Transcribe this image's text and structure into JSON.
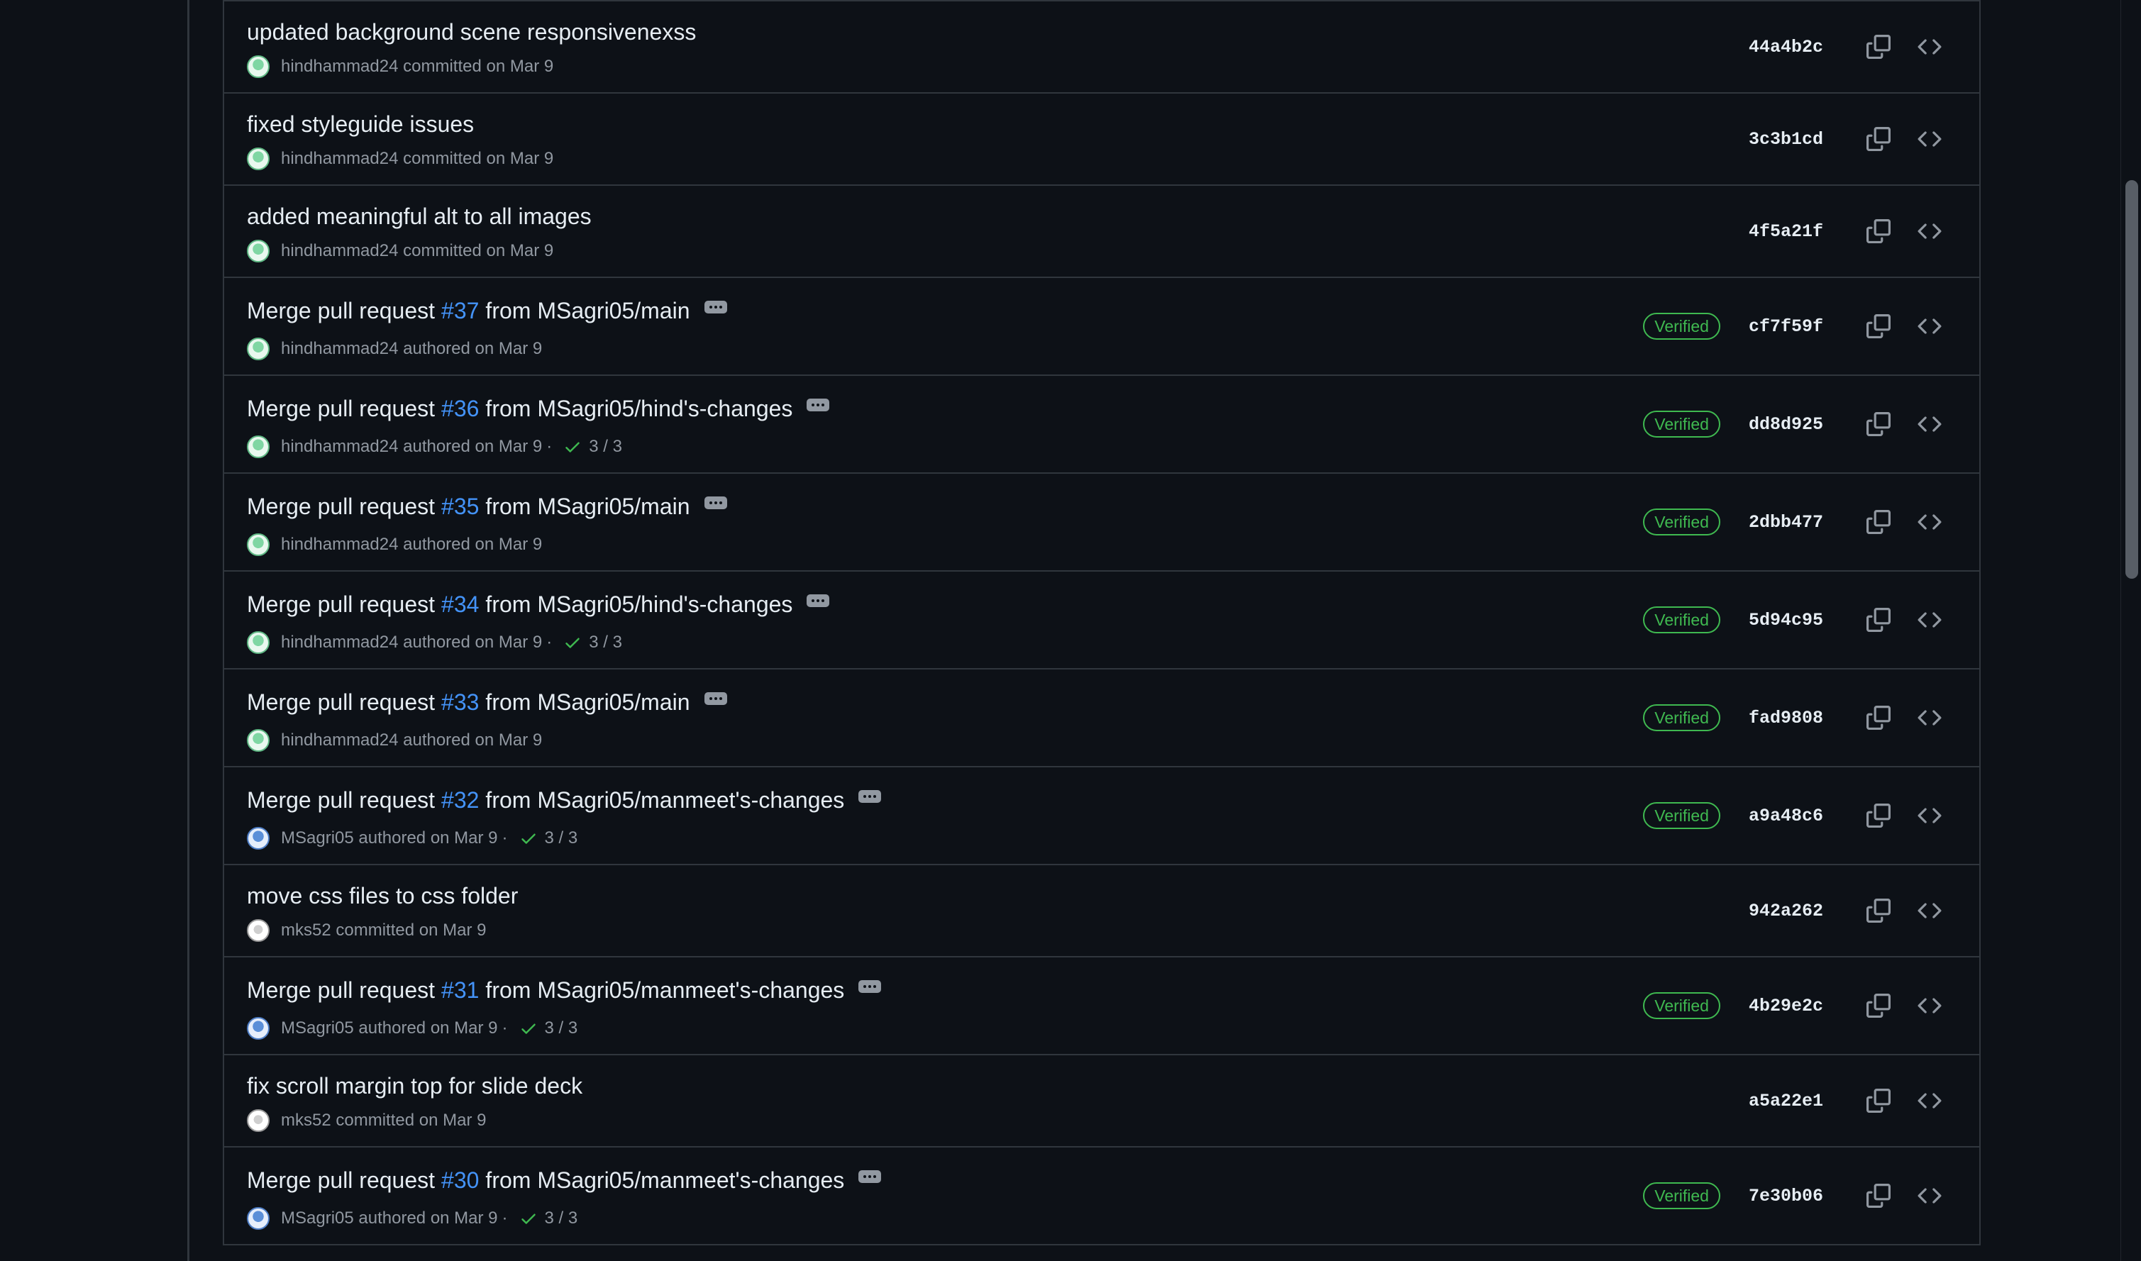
{
  "commits": [
    {
      "title": "updated background scene responsivenexss",
      "pr": "",
      "title_suffix": "",
      "has_pr": false,
      "author": "hindhammad24",
      "action": "committed",
      "date": "on Mar 9",
      "checks": "",
      "verified": "",
      "sha": "44a4b2c",
      "avatar": "green"
    },
    {
      "title": "fixed styleguide issues",
      "pr": "",
      "title_suffix": "",
      "has_pr": false,
      "author": "hindhammad24",
      "action": "committed",
      "date": "on Mar 9",
      "checks": "",
      "verified": "",
      "sha": "3c3b1cd",
      "avatar": "green"
    },
    {
      "title": "added meaningful alt to all images",
      "pr": "",
      "title_suffix": "",
      "has_pr": false,
      "author": "hindhammad24",
      "action": "committed",
      "date": "on Mar 9",
      "checks": "",
      "verified": "",
      "sha": "4f5a21f",
      "avatar": "green"
    },
    {
      "title": "Merge pull request",
      "pr": "#37",
      "title_suffix": "from MSagri05/main",
      "has_pr": true,
      "author": "hindhammad24",
      "action": "authored",
      "date": "on Mar 9",
      "checks": "",
      "verified": "Verified",
      "sha": "cf7f59f",
      "avatar": "green"
    },
    {
      "title": "Merge pull request",
      "pr": "#36",
      "title_suffix": "from MSagri05/hind's-changes",
      "has_pr": true,
      "author": "hindhammad24",
      "action": "authored",
      "date": "on Mar 9",
      "checks": "3 / 3",
      "verified": "Verified",
      "sha": "dd8d925",
      "avatar": "green"
    },
    {
      "title": "Merge pull request",
      "pr": "#35",
      "title_suffix": "from MSagri05/main",
      "has_pr": true,
      "author": "hindhammad24",
      "action": "authored",
      "date": "on Mar 9",
      "checks": "",
      "verified": "Verified",
      "sha": "2dbb477",
      "avatar": "green"
    },
    {
      "title": "Merge pull request",
      "pr": "#34",
      "title_suffix": "from MSagri05/hind's-changes",
      "has_pr": true,
      "author": "hindhammad24",
      "action": "authored",
      "date": "on Mar 9",
      "checks": "3 / 3",
      "verified": "Verified",
      "sha": "5d94c95",
      "avatar": "green"
    },
    {
      "title": "Merge pull request",
      "pr": "#33",
      "title_suffix": "from MSagri05/main",
      "has_pr": true,
      "author": "hindhammad24",
      "action": "authored",
      "date": "on Mar 9",
      "checks": "",
      "verified": "Verified",
      "sha": "fad9808",
      "avatar": "green"
    },
    {
      "title": "Merge pull request",
      "pr": "#32",
      "title_suffix": "from MSagri05/manmeet's-changes",
      "has_pr": true,
      "author": "MSagri05",
      "action": "authored",
      "date": "on Mar 9",
      "checks": "3 / 3",
      "verified": "Verified",
      "sha": "a9a48c6",
      "avatar": "blue"
    },
    {
      "title": "move css files to css folder",
      "pr": "",
      "title_suffix": "",
      "has_pr": false,
      "author": "mks52",
      "action": "committed",
      "date": "on Mar 9",
      "checks": "",
      "verified": "",
      "sha": "942a262",
      "avatar": "gray"
    },
    {
      "title": "Merge pull request",
      "pr": "#31",
      "title_suffix": "from MSagri05/manmeet's-changes",
      "has_pr": true,
      "author": "MSagri05",
      "action": "authored",
      "date": "on Mar 9",
      "checks": "3 / 3",
      "verified": "Verified",
      "sha": "4b29e2c",
      "avatar": "blue"
    },
    {
      "title": "fix scroll margin top for slide deck",
      "pr": "",
      "title_suffix": "",
      "has_pr": false,
      "author": "mks52",
      "action": "committed",
      "date": "on Mar 9",
      "checks": "",
      "verified": "",
      "sha": "a5a22e1",
      "avatar": "gray"
    },
    {
      "title": "Merge pull request",
      "pr": "#30",
      "title_suffix": "from MSagri05/manmeet's-changes",
      "has_pr": true,
      "author": "MSagri05",
      "action": "authored",
      "date": "on Mar 9",
      "checks": "3 / 3",
      "verified": "Verified",
      "sha": "7e30b06",
      "avatar": "blue"
    }
  ],
  "icons": {
    "copy": "copy-icon",
    "browse": "code-icon",
    "check": "check-icon",
    "more": "ellipsis-icon"
  },
  "colors": {
    "background": "#0d1117",
    "border": "#30363d",
    "link": "#4493f8",
    "verified": "#3fb950",
    "muted": "#9198a1"
  }
}
